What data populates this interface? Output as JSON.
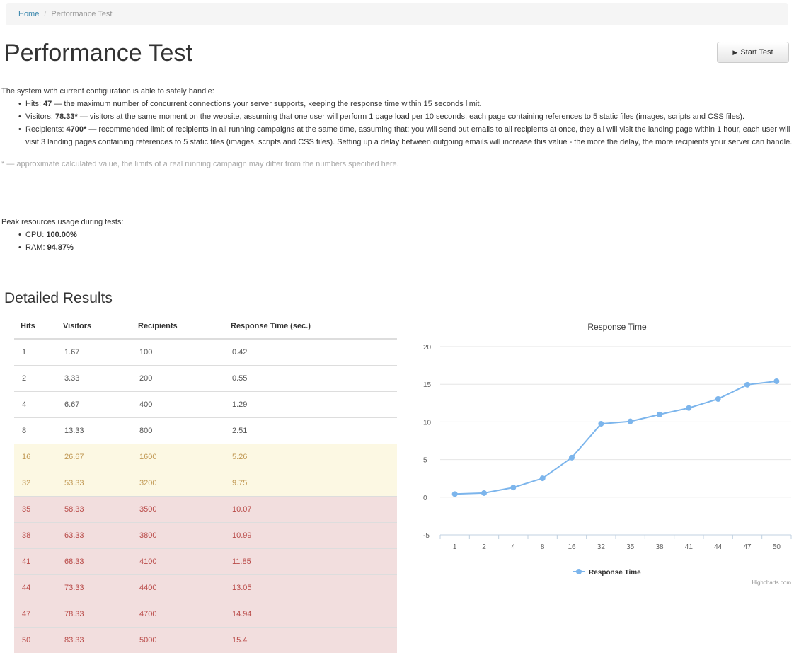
{
  "breadcrumb": {
    "home": "Home",
    "separator": "/",
    "current": "Performance Test"
  },
  "page": {
    "title": "Performance Test",
    "start_button": "Start Test",
    "start_icon": "play-icon"
  },
  "summary": {
    "intro": "The system with current configuration is able to safely handle:",
    "hits": {
      "label": "Hits:",
      "value": "47",
      "text": "— the maximum number of concurrent connections your server supports, keeping the response time within 15 seconds limit."
    },
    "visitors": {
      "label": "Visitors:",
      "value": "78.33*",
      "text": "— visitors at the same moment on the website, assuming that one user will perform 1 page load per 10 seconds, each page containing references to 5 static files (images, scripts and CSS files)."
    },
    "recipients": {
      "label": "Recipients:",
      "value": "4700*",
      "text": "— recommended limit of recipients in all running campaigns at the same time, assuming that: you will send out emails to all recipients at once, they all will visit the landing page within 1 hour, each user will visit 3 landing pages containing references to 5 static files (images, scripts and CSS files). Setting up a delay between outgoing emails will increase this value - the more the delay, the more recipients your server can handle."
    },
    "note": "* — approximate calculated value, the limits of a real running campaign may differ from the numbers specified here."
  },
  "peak": {
    "intro": "Peak resources usage during tests:",
    "cpu": {
      "label": "CPU:",
      "value": "100.00%"
    },
    "ram": {
      "label": "RAM:",
      "value": "94.87%"
    }
  },
  "detailed": {
    "title": "Detailed Results",
    "headers": [
      "Hits",
      "Visitors",
      "Recipients",
      "Response Time (sec.)"
    ],
    "rows": [
      [
        "1",
        "1.67",
        "100",
        "0.42"
      ],
      [
        "2",
        "3.33",
        "200",
        "0.55"
      ],
      [
        "4",
        "6.67",
        "400",
        "1.29"
      ],
      [
        "8",
        "13.33",
        "800",
        "2.51"
      ],
      [
        "16",
        "26.67",
        "1600",
        "5.26"
      ],
      [
        "32",
        "53.33",
        "3200",
        "9.75"
      ],
      [
        "35",
        "58.33",
        "3500",
        "10.07"
      ],
      [
        "38",
        "63.33",
        "3800",
        "10.99"
      ],
      [
        "41",
        "68.33",
        "4100",
        "11.85"
      ],
      [
        "44",
        "73.33",
        "4400",
        "13.05"
      ],
      [
        "47",
        "78.33",
        "4700",
        "14.94"
      ],
      [
        "50",
        "83.33",
        "5000",
        "15.4"
      ]
    ],
    "row_states": [
      "normal",
      "normal",
      "normal",
      "normal",
      "warning",
      "warning",
      "error",
      "error",
      "error",
      "error",
      "error",
      "error"
    ]
  },
  "colors": {
    "warning_bg": "#fcf8e3",
    "error_bg": "#f2dede",
    "series": "#7cb5ec",
    "grid": "#e6e6e6",
    "link": "#3a87ad"
  },
  "chart_data": {
    "type": "line",
    "title": "Response Time",
    "categories": [
      "1",
      "2",
      "4",
      "8",
      "16",
      "32",
      "35",
      "38",
      "41",
      "44",
      "47",
      "50"
    ],
    "series": [
      {
        "name": "Response Time",
        "values": [
          0.42,
          0.55,
          1.29,
          2.51,
          5.26,
          9.75,
          10.07,
          10.99,
          11.85,
          13.05,
          14.94,
          15.4
        ]
      }
    ],
    "yticks": [
      -5,
      0,
      5,
      10,
      15,
      20
    ],
    "ylim": [
      -5,
      20
    ],
    "grid": true,
    "legend": "bottom-center",
    "credits": "Highcharts.com"
  }
}
